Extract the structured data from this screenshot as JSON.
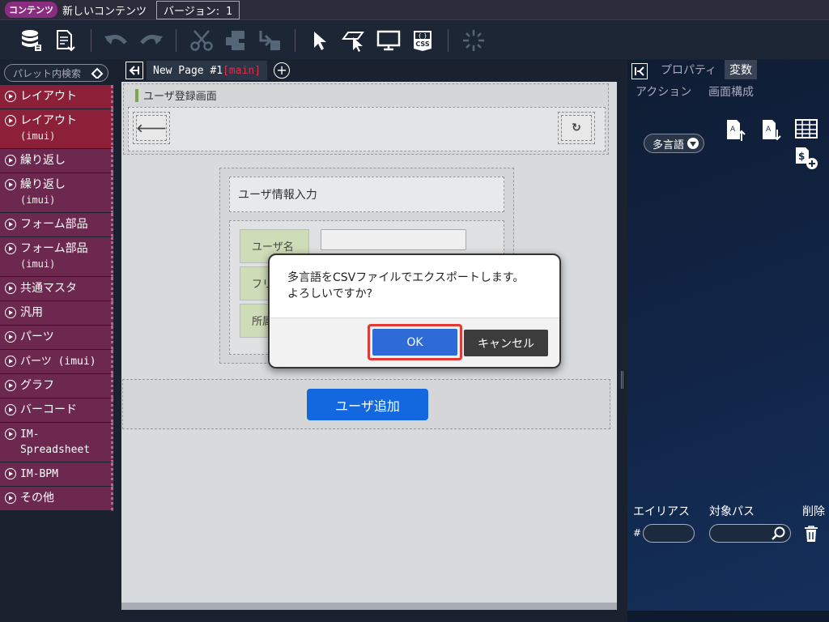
{
  "titlebar": {
    "badge": "コンテンツ",
    "title": "新しいコンテンツ",
    "version_label": "バージョン:",
    "version_number": "1"
  },
  "toolbar": {
    "icons": [
      "database-icon",
      "export-file-icon",
      "undo-icon",
      "redo-icon",
      "cut-icon",
      "copy-icon",
      "paste-icon",
      "select-cursor-icon",
      "pointer-icon",
      "monitor-preview-icon",
      "css-icon",
      "loading-icon"
    ]
  },
  "palette": {
    "search_placeholder": "パレット内検索",
    "items": [
      {
        "label": "レイアウト",
        "sub": "",
        "style": "red"
      },
      {
        "label": "レイアウト",
        "sub": "(imui)",
        "style": "red"
      },
      {
        "label": "繰り返し",
        "sub": "",
        "style": "purple"
      },
      {
        "label": "繰り返し",
        "sub": "(imui)",
        "style": "purple"
      },
      {
        "label": "フォーム部品",
        "sub": "",
        "style": "purple"
      },
      {
        "label": "フォーム部品",
        "sub": "(imui)",
        "style": "purple"
      },
      {
        "label": "共通マスタ",
        "sub": "",
        "style": "purple"
      },
      {
        "label": "汎用",
        "sub": "",
        "style": "purple"
      },
      {
        "label": "パーツ",
        "sub": "",
        "style": "purple"
      },
      {
        "label": "パーツ (imui)",
        "sub": "",
        "style": "purple"
      },
      {
        "label": "グラフ",
        "sub": "",
        "style": "purple"
      },
      {
        "label": "バーコード",
        "sub": "",
        "style": "purple"
      },
      {
        "label": "IM-Spreadsheet",
        "sub": "",
        "style": "purple"
      },
      {
        "label": "IM-BPM",
        "sub": "",
        "style": "purple"
      },
      {
        "label": "その他",
        "sub": "",
        "style": "purple"
      }
    ]
  },
  "tab": {
    "name": "New Page #1",
    "branch": "[main]"
  },
  "canvas": {
    "page_title": "ユーザ登録画面",
    "form_title": "ユーザ情報入力",
    "rows": [
      "ユーザ名",
      "フリ",
      "所属"
    ],
    "add_button": "ユーザ追加"
  },
  "rightpanel": {
    "tabs": {
      "properties": "プロパティ",
      "variables": "変数",
      "actions": "アクション",
      "structure": "画面構成"
    },
    "lang_dropdown": "多言語",
    "columns": {
      "alias": "エイリアス",
      "path": "対象パス",
      "delete": "削除"
    },
    "hash": "#"
  },
  "dialog": {
    "line1": "多言語をCSVファイルでエクスポートします。",
    "line2": "よろしいですか?",
    "ok": "OK",
    "cancel": "キャンセル"
  }
}
